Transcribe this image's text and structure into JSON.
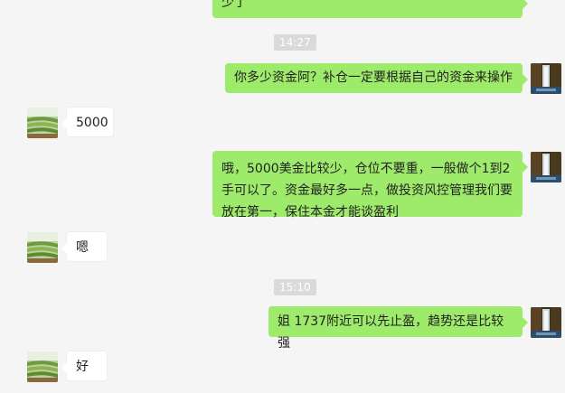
{
  "chat": {
    "messages": [
      {
        "kind": "text",
        "from": "self",
        "text": "少了"
      },
      {
        "kind": "time",
        "text": "14:27"
      },
      {
        "kind": "text",
        "from": "self",
        "text": "你多少资金阿？补仓一定要根据自己的资金来操作"
      },
      {
        "kind": "text",
        "from": "other",
        "text": "5000"
      },
      {
        "kind": "text",
        "from": "self",
        "text": "哦，5000美金比较少，仓位不要重，一般做个1到2手可以了。资金最好多一点，做投资风控管理我们要放在第一，保住本金才能谈盈利"
      },
      {
        "kind": "text",
        "from": "other",
        "text": "嗯"
      },
      {
        "kind": "time",
        "text": "15:10"
      },
      {
        "kind": "text",
        "from": "self",
        "text": "姐 1737附近可以先止盈，趋势还是比较强"
      },
      {
        "kind": "text",
        "from": "other",
        "text": "好"
      }
    ]
  },
  "colors": {
    "self_bubble": "#9eea6a",
    "other_bubble": "#ffffff",
    "timestamp_bg": "#dadada",
    "background": "#f5f5f5"
  },
  "icons": {
    "self_avatar": "waterfall-photo-avatar",
    "other_avatar": "terraced-fields-avatar"
  }
}
